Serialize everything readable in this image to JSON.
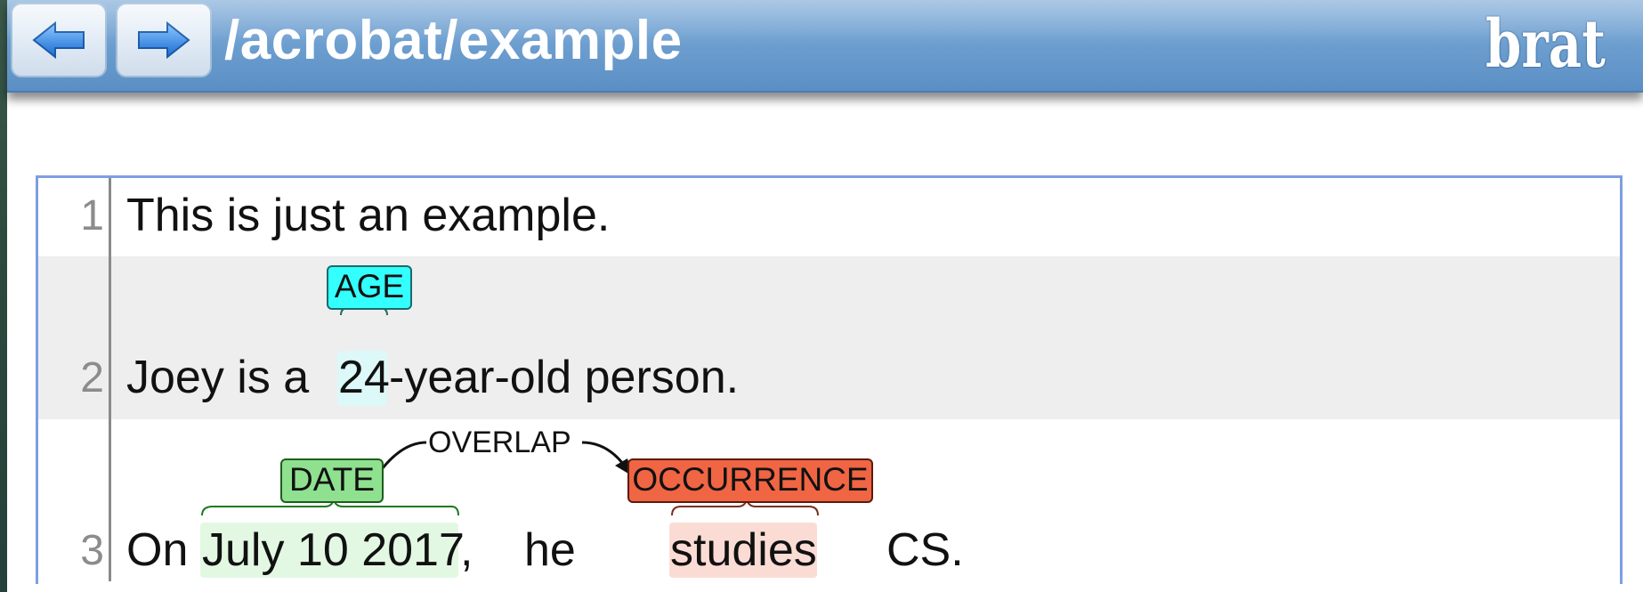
{
  "app": {
    "title": "/acrobat/example",
    "logo": "brat",
    "prev_icon": "arrow-left-icon",
    "next_icon": "arrow-right-icon"
  },
  "document": {
    "lines": [
      {
        "number": "1",
        "text": "This is just an example."
      },
      {
        "number": "2",
        "pre": "Joey is a ",
        "span": "24",
        "post": "-year-old person."
      },
      {
        "number": "3",
        "w1": "On",
        "date": "July 10 2017",
        "comma": ",",
        "w2": "he",
        "occ": "studies",
        "w3": "CS."
      }
    ],
    "annotations": {
      "age": {
        "label": "AGE",
        "color": "#33ffff",
        "span_color": "#dcf8f8"
      },
      "date": {
        "label": "DATE",
        "color": "#8fe08f",
        "span_color": "#e3f8e3"
      },
      "occurrence": {
        "label": "OCCURRENCE",
        "color": "#f06543",
        "span_color": "#fbdcd4"
      },
      "relation": {
        "label": "OVERLAP"
      }
    }
  }
}
